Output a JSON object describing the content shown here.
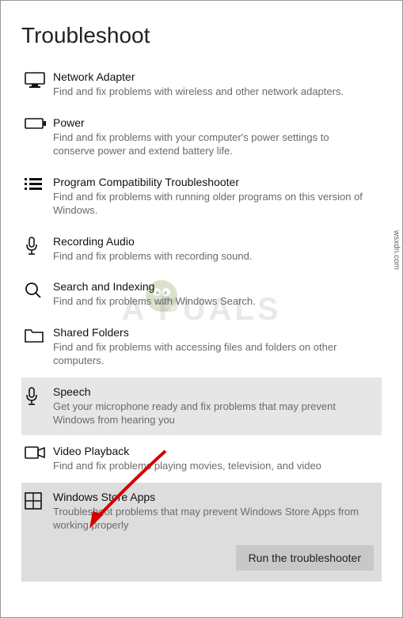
{
  "page_title": "Troubleshoot",
  "watermark_text": "A     PUALS",
  "source_label": "wsxdn.com",
  "items": [
    {
      "title": "Network Adapter",
      "desc": "Find and fix problems with wireless and other network adapters.",
      "selected": false
    },
    {
      "title": "Power",
      "desc": "Find and fix problems with your computer's power settings to conserve power and extend battery life.",
      "selected": false
    },
    {
      "title": "Program Compatibility Troubleshooter",
      "desc": "Find and fix problems with running older programs on this version of Windows.",
      "selected": false
    },
    {
      "title": "Recording Audio",
      "desc": "Find and fix problems with recording sound.",
      "selected": false
    },
    {
      "title": "Search and Indexing",
      "desc": "Find and fix problems with Windows Search.",
      "selected": false
    },
    {
      "title": "Shared Folders",
      "desc": "Find and fix problems with accessing files and folders on other computers.",
      "selected": false
    },
    {
      "title": "Speech",
      "desc": "Get your microphone ready and fix problems that may prevent Windows from hearing you",
      "selected": true
    },
    {
      "title": "Video Playback",
      "desc": "Find and fix problems playing movies, television, and video",
      "selected": false
    },
    {
      "title": "Windows Store Apps",
      "desc": "Troubleshoot problems that may prevent Windows Store Apps from working properly",
      "selected": true,
      "hover": true
    }
  ],
  "run_button_label": "Run the troubleshooter"
}
